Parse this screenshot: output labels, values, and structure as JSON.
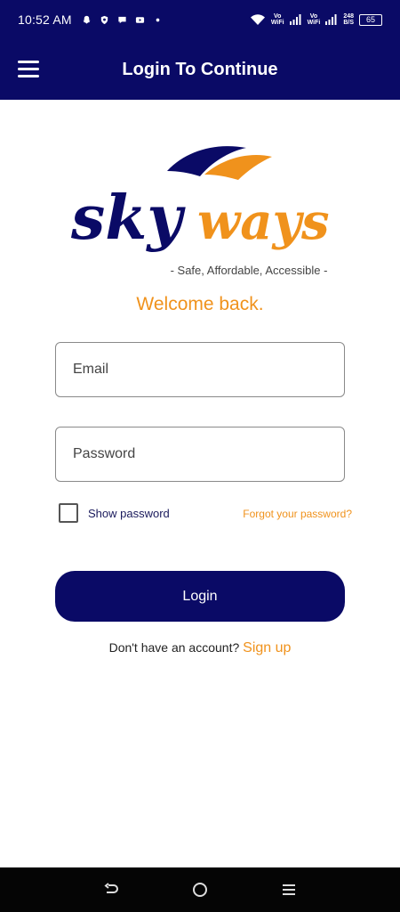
{
  "status_bar": {
    "time": "10:52 AM",
    "notification_icons": [
      "snapchat-icon",
      "shield-icon",
      "chat-icon",
      "youtube-icon",
      "dot-icon"
    ],
    "volte1": "Vo\nWiFi",
    "volte2": "Vo\nWiFi",
    "speed_value": "248",
    "speed_unit": "B/S",
    "battery": "65"
  },
  "app_bar": {
    "title": "Login To Continue",
    "menu_icon": "hamburger-menu-icon"
  },
  "brand": {
    "logo_sky": "sky",
    "logo_ways": "ways",
    "tagline": "- Safe, Affordable, Accessible -",
    "colors": {
      "navy": "#0a0a66",
      "orange": "#f0921c"
    }
  },
  "login_form": {
    "welcome": "Welcome back.",
    "email_placeholder": "Email",
    "email_value": "",
    "password_placeholder": "Password",
    "password_value": "",
    "show_password_label": "Show password",
    "show_password_checked": false,
    "forgot_password": "Forgot your password?",
    "login_button": "Login",
    "signup_prompt": "Don't have an account?",
    "signup_link": "Sign up"
  },
  "nav_bar": {
    "buttons": [
      "back-icon",
      "home-icon",
      "recents-icon"
    ]
  }
}
